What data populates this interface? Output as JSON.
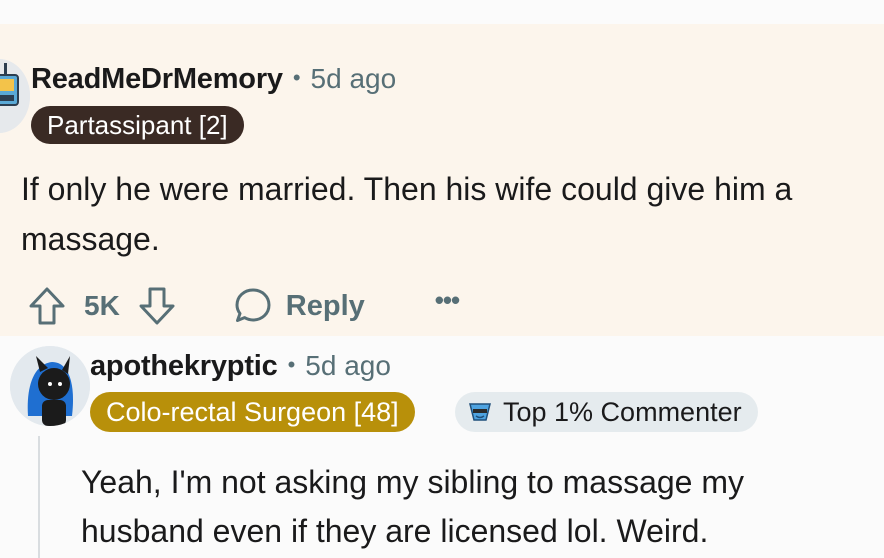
{
  "comments": [
    {
      "username": "ReadMeDrMemory",
      "separator": "•",
      "time": "5d ago",
      "flair": "Partassipant [2]",
      "body": "If only he were married. Then his wife could give him a massage.",
      "votes": "5K",
      "reply_label": "Reply",
      "more_label": "•••"
    },
    {
      "username": "apothekryptic",
      "separator": "•",
      "time": "5d ago",
      "flair": "Colo-rectal Surgeon [48]",
      "badge": "Top 1% Commenter",
      "body": "Yeah, I'm not asking my sibling to massage my husband even if they are licensed lol. Weird."
    }
  ],
  "colors": {
    "highlight_bg": "#fcf5ec",
    "flair_dark": "#3a2a24",
    "flair_gold": "#b8900a",
    "meta_gray": "#576f76"
  },
  "icons": [
    "upvote-icon",
    "downvote-icon",
    "comment-icon",
    "top-commenter-icon"
  ]
}
